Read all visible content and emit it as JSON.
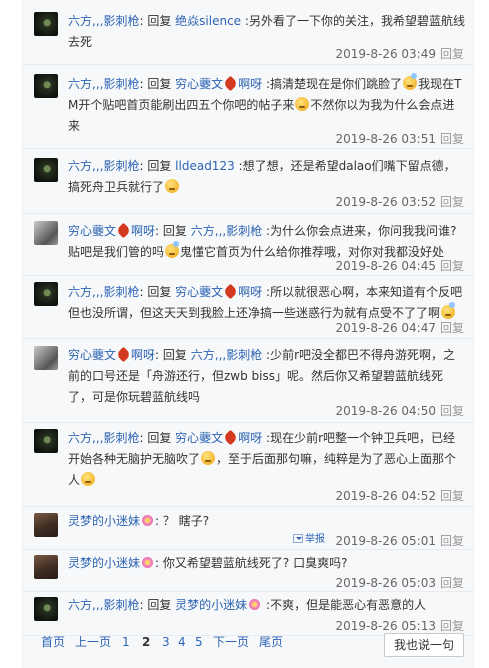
{
  "reply_word": "回复",
  "colon": ":",
  "replies": [
    {
      "avatar": "dark",
      "author": "六方,,,影刺枪",
      "target": "绝焱silence",
      "text": "另外看了一下你的关注，我希望碧蓝航线去死",
      "time": "2019-8-26 03:49",
      "action": "回复"
    },
    {
      "avatar": "dark",
      "author": "六方,,,影刺枪",
      "target": "穷心虁文",
      "target_badge": "leaf",
      "target_suffix": "啊呀",
      "text_parts": [
        "搞清楚现在是你们跳脸了",
        "我现在TM开个贴吧首页能刷出四五个你吧的帖子来",
        "不然你以为我为什么会点进来"
      ],
      "emoticons": [
        "note-smiley",
        "smiley"
      ],
      "time": "2019-8-26 03:51",
      "action": "回复"
    },
    {
      "avatar": "dark",
      "author": "六方,,,影刺枪",
      "target": "lldead123",
      "text": "想了想，还是希望dalao们嘴下留点德，搞死舟卫兵就行了",
      "emoticon_end": "smiley",
      "time": "2019-8-26 03:52",
      "action": "回复"
    },
    {
      "avatar": "gray",
      "author": "穷心虁文",
      "author_badge": "leaf",
      "author_suffix": "啊呀",
      "target": "六方,,,影刺枪",
      "text_parts": [
        "为什么你会点进来，你问我我问谁?贴吧是我们管的吗",
        "鬼懂它首页为什么给你推荐哦，对你对我都没好处"
      ],
      "emoticons": [
        "note-smiley"
      ],
      "time": "2019-8-26 04:45",
      "action": "回复"
    },
    {
      "avatar": "dark",
      "author": "六方,,,影刺枪",
      "target": "穷心虁文",
      "target_badge": "leaf",
      "target_suffix": "啊呀",
      "text_parts": [
        "所以就很恶心啊，本来知道有个反吧但也没所谓，但这天天到我脸上还净搞一些迷惑行为就有点受不了了啊",
        ""
      ],
      "emoticons": [
        "note-smiley"
      ],
      "time": "2019-8-26 04:47",
      "action": "回复"
    },
    {
      "avatar": "gray",
      "author": "穷心虁文",
      "author_badge": "leaf",
      "author_suffix": "啊呀",
      "target": "六方,,,影刺枪",
      "text": "少前r吧没全都巴不得舟游死啊，之前的口号还是「舟游还行，但zwb biss」呢。然后你又希望碧蓝航线死了，可是你玩碧蓝航线吗",
      "time": "2019-8-26 04:50",
      "action": "回复"
    },
    {
      "avatar": "dark",
      "author": "六方,,,影刺枪",
      "target": "穷心虁文",
      "target_badge": "leaf",
      "target_suffix": "啊呀",
      "text_parts": [
        "现在少前r吧整一个钟卫兵吧，已经开始各种无脑护无脑吹了",
        "，至于后面那句嘛，纯粹是为了恶心上面那个人",
        ""
      ],
      "emoticons": [
        "smiley",
        "smiley"
      ],
      "time": "2019-8-26 04:52",
      "action": "回复"
    },
    {
      "avatar": "brown",
      "author": "灵梦的小迷妹",
      "author_badge": "flower",
      "text": "？ 瞎子?",
      "report": "举报",
      "time": "2019-8-26 05:01",
      "action": "回复"
    },
    {
      "avatar": "brown",
      "author": "灵梦的小迷妹",
      "author_badge": "flower",
      "text": "你又希望碧蓝航线死了? 口臭爽吗?",
      "time": "2019-8-26 05:03",
      "action": "回复"
    },
    {
      "avatar": "dark",
      "author": "六方,,,影刺枪",
      "target": "灵梦的小迷妹",
      "target_badge": "flower",
      "text": "不爽，但是能恶心有恶意的人",
      "time": "2019-8-26 05:13",
      "action": "回复"
    }
  ],
  "pagination": {
    "first": "首页",
    "prev": "上一页",
    "pages": [
      "1",
      "2",
      "3",
      "4",
      "5"
    ],
    "current": "2",
    "next": "下一页",
    "last": "尾页"
  },
  "say_button": "我也说一句",
  "colors": {
    "link": "#2d64b3",
    "text": "#333333",
    "meta": "#666666",
    "panel": "#f7f8fa"
  },
  "icons": [
    "smiley-emoticon",
    "note-smiley-emoticon",
    "maple-leaf-badge",
    "flower-badge",
    "report-icon"
  ]
}
